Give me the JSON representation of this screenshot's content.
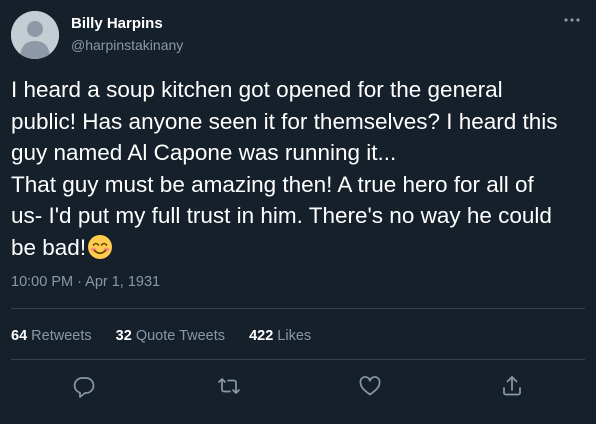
{
  "tweet": {
    "author": {
      "display_name": "Billy Harpins",
      "handle": "@harpinstakinany"
    },
    "body_lines": [
      "I heard a soup kitchen got opened for the general",
      "public! Has anyone seen it for themselves? I heard this",
      "guy named Al Capone was running it...",
      "That guy must be amazing then! A true hero for all of",
      "us- I'd put my full trust in him. There's no way he could",
      "be bad!"
    ],
    "emoji": "smiling-face-with-smiling-eyes",
    "timestamp": "10:00 PM · Apr 1, 1931",
    "stats": {
      "retweets": {
        "count": "64",
        "label": "Retweets"
      },
      "quote_tweets": {
        "count": "32",
        "label": "Quote Tweets"
      },
      "likes": {
        "count": "422",
        "label": "Likes"
      }
    }
  },
  "colors": {
    "background": "#15202b",
    "text": "#ffffff",
    "secondary_text": "#8899a6",
    "divider": "#38444d"
  }
}
